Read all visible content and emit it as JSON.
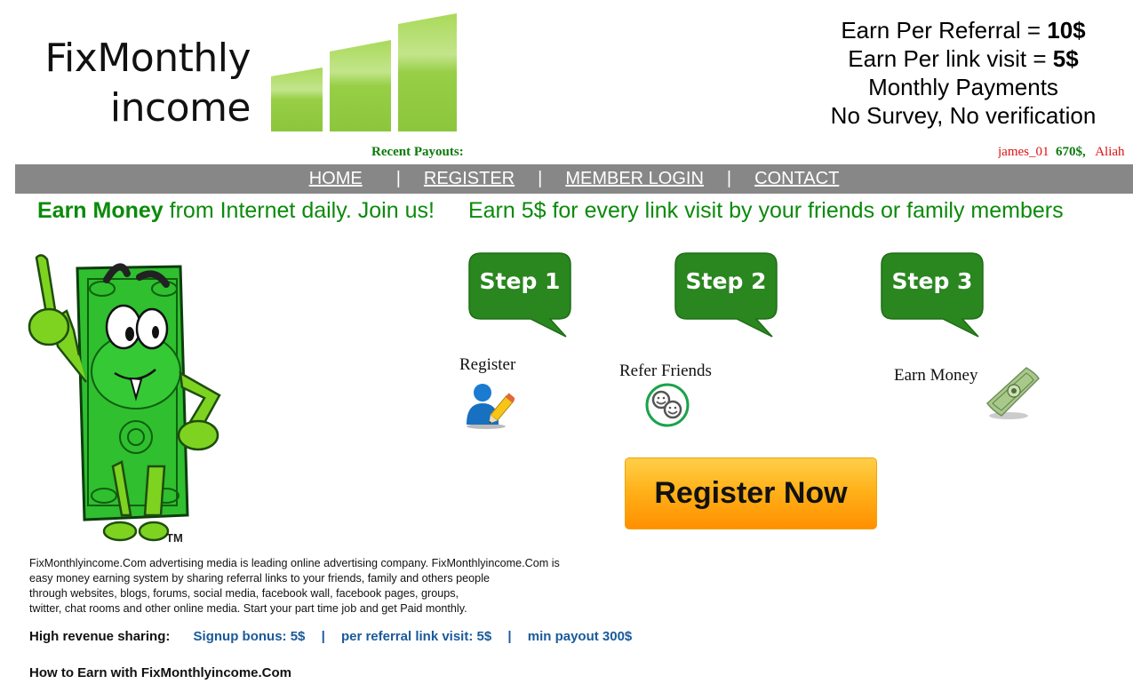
{
  "header": {
    "logo": {
      "line1": "FixMonthly",
      "line2": "income",
      "bars_color": "#8dc63f"
    },
    "promo": {
      "line1_text": "Earn Per Referral  = ",
      "line1_value": "10$",
      "line2_text": "Earn Per link visit = ",
      "line2_value": "5$",
      "line3": "Monthly Payments",
      "line4": "No Survey, No verification"
    }
  },
  "recent_payouts": {
    "label": "Recent Payouts:",
    "items": [
      {
        "name": "james_01",
        "amount": "670$,"
      },
      {
        "name": "Aliah",
        "amount": ""
      }
    ]
  },
  "nav": {
    "items": [
      {
        "label": "HOME"
      },
      {
        "label": "REGISTER"
      },
      {
        "label": "MEMBER LOGIN"
      },
      {
        "label": "CONTACT"
      }
    ],
    "separator": "|",
    "bg_color": "#878787"
  },
  "tagline": {
    "bold": "Earn Money",
    "rest": " from Internet daily. Join us!",
    "second": "Earn 5$ for every link visit by your friends or family members",
    "color": "#0b8a0b"
  },
  "mascot": {
    "icon": "dollar-bill-mascot",
    "trademark": "TM"
  },
  "steps": [
    {
      "bubble": "Step 1",
      "label": "Register",
      "icon": "user-edit-icon"
    },
    {
      "bubble": "Step 2",
      "label": "Refer Friends",
      "icon": "smileys-icon"
    },
    {
      "bubble": "Step 3",
      "label": "Earn Money",
      "icon": "dollar-bill-icon"
    }
  ],
  "cta": {
    "label": "Register Now"
  },
  "description": {
    "lines": [
      "FixMonthlyincome.Com advertising media is leading online advertising company. FixMonthlyincome.Com is",
      "easy money earning system by sharing referral links to your friends, family and others people",
      "through websites, blogs, forums, social media, facebook wall, facebook pages, groups,",
      "twitter, chat rooms and other online media. Start your part time job and get Paid monthly."
    ]
  },
  "revenue": {
    "label": "High revenue sharing:",
    "signup": "Signup bonus:  5$",
    "per_visit": "per referral link visit: 5$",
    "min_payout": "min payout 300$",
    "separator": "|"
  },
  "howto": {
    "title": "How to Earn with FixMonthlyincome.Com"
  }
}
